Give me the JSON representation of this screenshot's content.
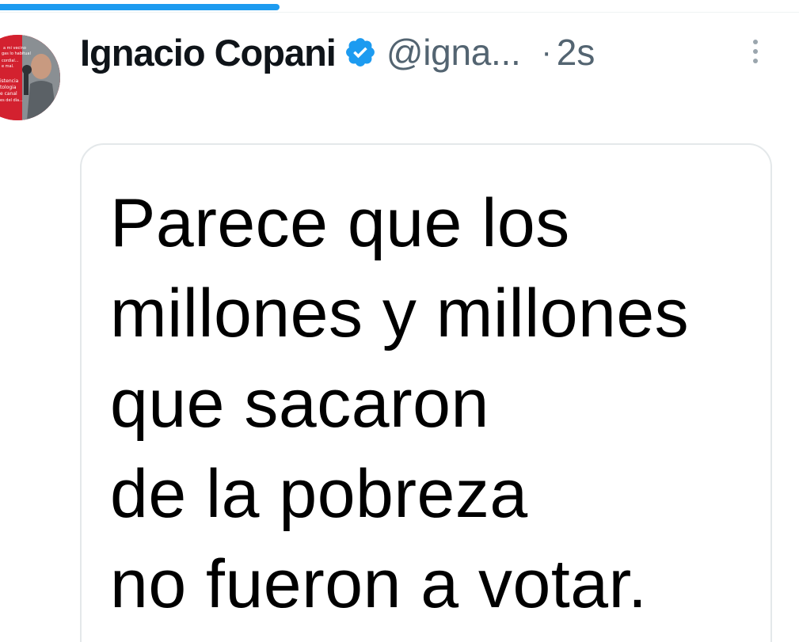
{
  "progress": {
    "fraction": 0.35,
    "color": "#1d9bf0"
  },
  "tweet": {
    "author": {
      "display_name": "Ignacio Copani",
      "handle": "@igna...",
      "verified": true,
      "avatar_icon": "profile-photo",
      "avatar_text": [
        "a mi vecino",
        "gas lo habitual",
        "cordial...",
        "e mal.",
        "istencia",
        "tologia",
        "e canal",
        "es del día..."
      ]
    },
    "separator": "·",
    "timestamp": "2s",
    "more_icon": "vertical-ellipsis-icon",
    "media": {
      "lines": [
        "Parece que los",
        "millones y millones",
        "que sacaron",
        "de la pobreza",
        "no fueron a votar."
      ]
    }
  },
  "colors": {
    "accent": "#1d9bf0",
    "text_primary": "#0f1419",
    "text_secondary": "#536471",
    "border": "#e4e8ea"
  }
}
